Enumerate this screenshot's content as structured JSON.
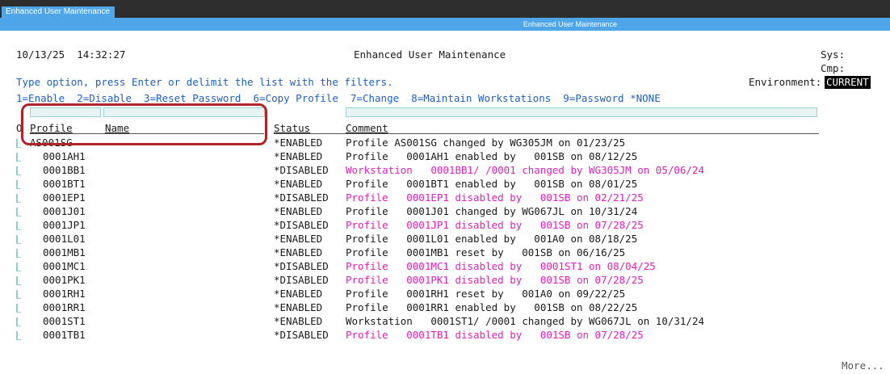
{
  "window": {
    "tab_label": "Enhanced User Maintenance",
    "title": "Enhanced User Maintenance"
  },
  "header": {
    "datetime": "10/13/25  14:32:27",
    "screen_title": "Enhanced User Maintenance",
    "sys_label": "Sys:",
    "cmp_label": "Cmp:",
    "environment_label": "Environment:",
    "environment_value": "CURRENT"
  },
  "instructions": {
    "line1": "Type option, press Enter or delimit the list with the filters.",
    "options": "1=Enable  2=Disable  3=Reset Password  6=Copy Profile  7=Change  8=Maintain Workstations  9=Password *NONE"
  },
  "filters": {
    "profile_value": "",
    "name_value": "",
    "comment_value": ""
  },
  "columns": {
    "opt": "O",
    "profile": "Profile",
    "name": "Name",
    "status": "Status",
    "comment": "Comment"
  },
  "rows": [
    {
      "profile": "AS001SG",
      "status": "*ENABLED",
      "comment": "Profile AS001SG changed by WG305JM on 01/23/25",
      "color": "#1a1a1a"
    },
    {
      "profile": "0001AH1",
      "status": "*ENABLED",
      "comment": "Profile   0001AH1 enabled by   001SB on 08/12/25",
      "color": "#1a1a1a"
    },
    {
      "profile": "0001BB1",
      "status": "*DISABLED",
      "comment": "Workstation   0001BB1/ /0001 changed by WG305JM on 05/06/24",
      "color": "#e21fb7"
    },
    {
      "profile": "0001BT1",
      "status": "*ENABLED",
      "comment": "Profile   0001BT1 enabled by   001SB on 08/01/25",
      "color": "#1a1a1a"
    },
    {
      "profile": "0001EP1",
      "status": "*DISABLED",
      "comment": "Profile   0001EP1 disabled by   001SB on 02/21/25",
      "color": "#e21fb7"
    },
    {
      "profile": "0001J01",
      "status": "*ENABLED",
      "comment": "Profile   0001J01 changed by WG067JL on 10/31/24",
      "color": "#1a1a1a"
    },
    {
      "profile": "0001JP1",
      "status": "*DISABLED",
      "comment": "Profile   0001JP1 disabled by   001SB on 07/28/25",
      "color": "#e21fb7"
    },
    {
      "profile": "0001L01",
      "status": "*ENABLED",
      "comment": "Profile   0001L01 enabled by   001A0 on 08/18/25",
      "color": "#1a1a1a"
    },
    {
      "profile": "0001MB1",
      "status": "*ENABLED",
      "comment": "Profile   0001MB1 reset by   001SB on 06/16/25",
      "color": "#1a1a1a"
    },
    {
      "profile": "0001MC1",
      "status": "*DISABLED",
      "comment": "Profile   0001MC1 disabled by   0001ST1 on 08/04/25",
      "color": "#e21fb7"
    },
    {
      "profile": "0001PK1",
      "status": "*DISABLED",
      "comment": "Profile   0001PK1 disabled by   001SB on 07/28/25",
      "color": "#e21fb7"
    },
    {
      "profile": "0001RH1",
      "status": "*ENABLED",
      "comment": "Profile   0001RH1 reset by   001A0 on 09/22/25",
      "color": "#1a1a1a"
    },
    {
      "profile": "0001RR1",
      "status": "*ENABLED",
      "comment": "Profile   0001RR1 enabled by   001SB on 08/22/25",
      "color": "#1a1a1a"
    },
    {
      "profile": "0001ST1",
      "status": "*ENABLED",
      "comment": "Workstation   0001ST1/ /0001 changed by WG067JL on 10/31/24",
      "color": "#1a1a1a"
    },
    {
      "profile": "0001TB1",
      "status": "*DISABLED",
      "comment": "Profile   0001TB1 disabled by   001SB on 07/28/25",
      "color": "#e21fb7"
    }
  ],
  "footer": {
    "more": "More..."
  }
}
